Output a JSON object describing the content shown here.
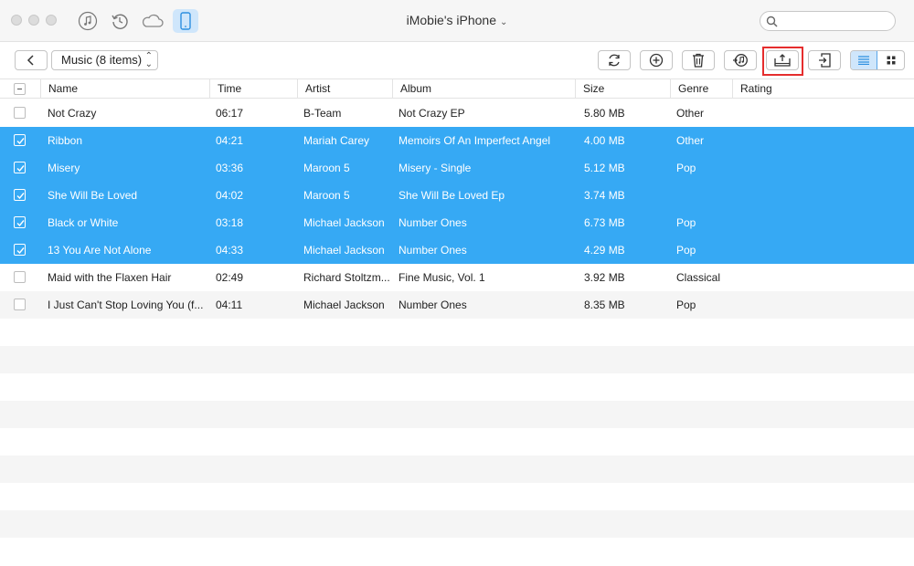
{
  "window": {
    "device_title": "iMobie's iPhone",
    "nav_icons": [
      "music-note-icon",
      "restore-icon",
      "cloud-icon",
      "phone-icon"
    ],
    "search_placeholder": ""
  },
  "toolbar": {
    "category_select": "Music (8 items)",
    "buttons": [
      "back-icon",
      "refresh-icon",
      "add-icon",
      "trash-icon",
      "itunes-transfer-icon",
      "export-to-computer-icon",
      "send-to-device-icon",
      "list-view-icon",
      "grid-view-icon"
    ],
    "active_view": "list",
    "highlighted_button": "export-to-computer"
  },
  "table": {
    "columns": [
      "Name",
      "Time",
      "Artist",
      "Album",
      "Size",
      "Genre",
      "Rating"
    ],
    "rows": [
      {
        "checked": false,
        "name": "Not Crazy",
        "time": "06:17",
        "artist": "B-Team",
        "album": "Not Crazy EP",
        "size": "5.80 MB",
        "genre": "Other"
      },
      {
        "checked": true,
        "name": "Ribbon",
        "time": "04:21",
        "artist": "Mariah Carey",
        "album": "Memoirs Of An Imperfect Angel",
        "size": "4.00 MB",
        "genre": "Other"
      },
      {
        "checked": true,
        "name": "Misery",
        "time": "03:36",
        "artist": "Maroon 5",
        "album": "Misery - Single",
        "size": "5.12 MB",
        "genre": "Pop"
      },
      {
        "checked": true,
        "name": "She Will Be Loved",
        "time": "04:02",
        "artist": "Maroon 5",
        "album": "She Will Be Loved Ep",
        "size": "3.74 MB",
        "genre": ""
      },
      {
        "checked": true,
        "name": "Black or White",
        "time": "03:18",
        "artist": "Michael Jackson",
        "album": "Number Ones",
        "size": "6.73 MB",
        "genre": "Pop"
      },
      {
        "checked": true,
        "name": "13 You Are Not Alone",
        "time": "04:33",
        "artist": "Michael Jackson",
        "album": "Number Ones",
        "size": "4.29 MB",
        "genre": "Pop"
      },
      {
        "checked": false,
        "name": "Maid with the Flaxen Hair",
        "time": "02:49",
        "artist": "Richard Stoltzm...",
        "album": "Fine Music, Vol. 1",
        "size": "3.92 MB",
        "genre": "Classical"
      },
      {
        "checked": false,
        "name": "I Just Can't Stop Loving You (f...",
        "time": "04:11",
        "artist": "Michael Jackson",
        "album": "Number Ones",
        "size": "8.35 MB",
        "genre": "Pop"
      }
    ]
  },
  "colors": {
    "selection": "#36a9f4",
    "highlight_box": "#e52d2d",
    "active_tab": "#cfe6fb"
  }
}
